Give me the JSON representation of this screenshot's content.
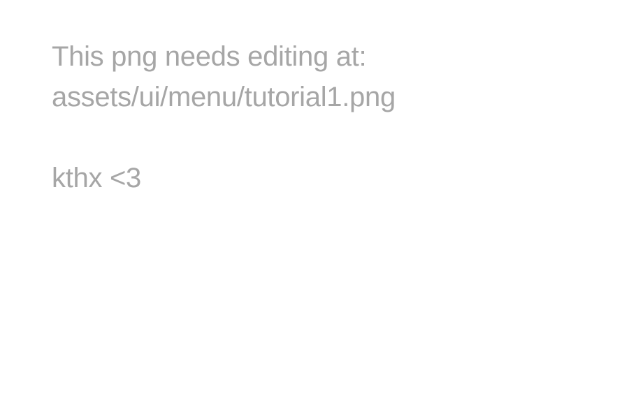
{
  "message": {
    "line1": "This png needs editing at:",
    "line2": "assets/ui/menu/tutorial1.png",
    "line3": "kthx <3"
  },
  "colors": {
    "background": "#ffffff",
    "text": "#a6a6a6"
  }
}
